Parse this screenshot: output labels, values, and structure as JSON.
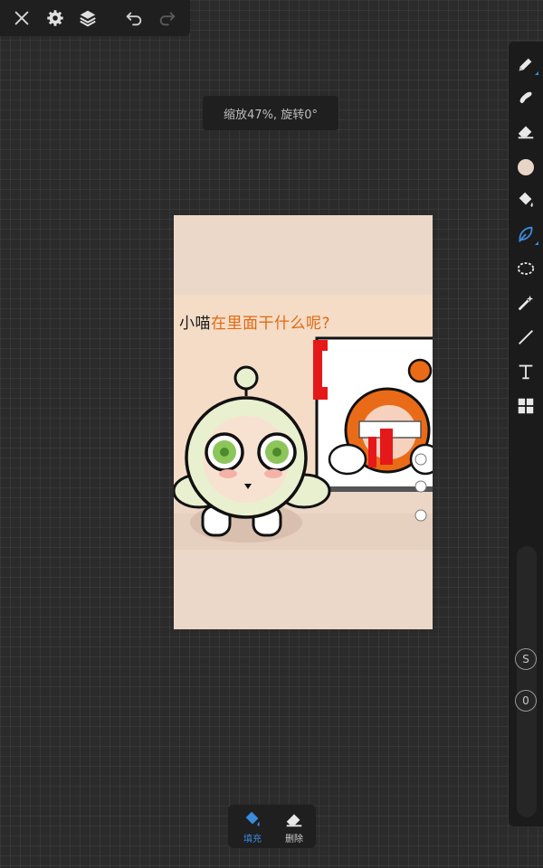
{
  "zoom_indicator": "缩放47%, 旋转0°",
  "canvas": {
    "caption_part1": "小喵",
    "caption_part2": "在里面干什么呢?"
  },
  "sidebar": {
    "s_label": "S",
    "o_label": "0"
  },
  "bottom_menu": {
    "fill_label": "填充",
    "delete_label": "删除"
  },
  "colors": {
    "accent": "#3b8bdc",
    "current_color": "#e8d5c7",
    "caption_orange": "#e06a12",
    "canvas_bg": "#ecd8c8"
  },
  "icons": [
    "close-icon",
    "gear-icon",
    "layers-icon",
    "undo-icon",
    "redo-icon",
    "pen-icon",
    "smudge-icon",
    "eraser-icon",
    "color-swatch",
    "fill-bucket-icon",
    "lasso-fill-icon",
    "lasso-select-icon",
    "magic-wand-icon",
    "line-icon",
    "text-icon",
    "grid-icon"
  ]
}
